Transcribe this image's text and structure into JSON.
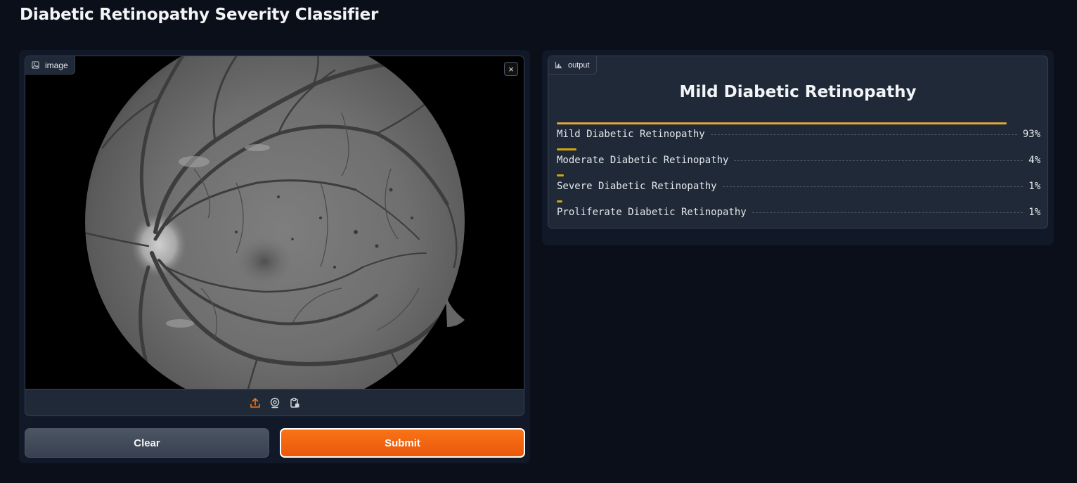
{
  "page": {
    "title": "Diabetic Retinopathy Severity Classifier"
  },
  "input": {
    "label": "image",
    "close_glyph": "×",
    "toolbar_icons": [
      "upload-icon",
      "webcam-icon",
      "clipboard-icon"
    ]
  },
  "buttons": {
    "clear": "Clear",
    "submit": "Submit"
  },
  "output": {
    "label": "output",
    "prediction": "Mild Diabetic Retinopathy",
    "confidences": [
      {
        "label": "Mild Diabetic Retinopathy",
        "pct": "93%",
        "value": 0.93
      },
      {
        "label": "Moderate Diabetic Retinopathy",
        "pct": "4%",
        "value": 0.04
      },
      {
        "label": "Severe Diabetic Retinopathy",
        "pct": "1%",
        "value": 0.015
      },
      {
        "label": "Proliferate Diabetic Retinopathy",
        "pct": "1%",
        "value": 0.012
      }
    ]
  },
  "colors": {
    "background": "#0b0f19",
    "panel": "#111827",
    "block": "#1f2937",
    "accent": "#f97316",
    "bar": "#eab308"
  }
}
